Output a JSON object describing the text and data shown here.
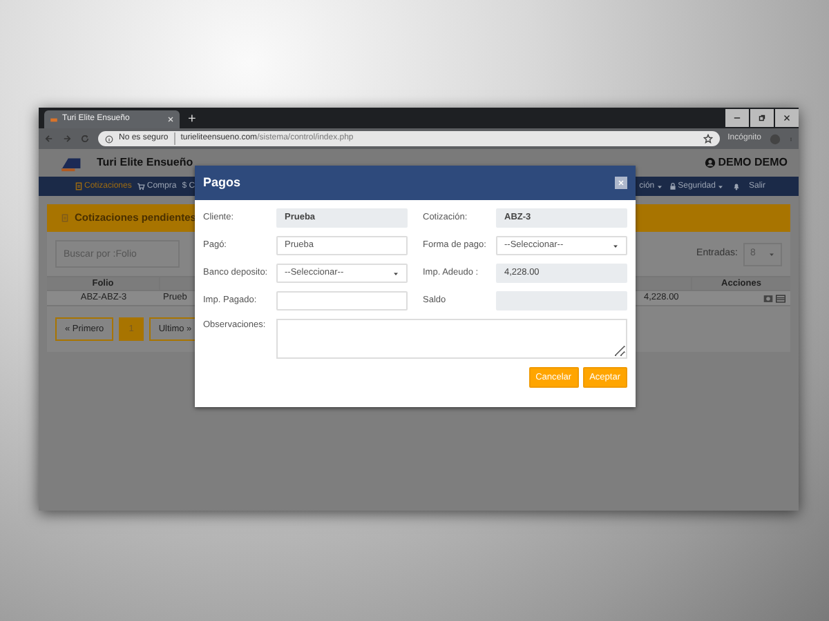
{
  "browser": {
    "tab_title": "Turi Elite Ensueño",
    "new_tab": "+",
    "security": "No es seguro",
    "url_host": "turieliteensueno.com",
    "url_path": "/sistema/control/index.php",
    "profile": "Incógnito"
  },
  "app": {
    "brand": "Turi Elite Ensueño",
    "user": "DEMO DEMO",
    "nav": [
      {
        "label": "Cotizaciones",
        "kind": "document",
        "selected": true
      },
      {
        "label": "Compra",
        "kind": "cart",
        "selected": false
      },
      {
        "label": "$ C",
        "kind": "text",
        "selected": false
      },
      {
        "label": "ción",
        "kind": "menu",
        "selected": false
      },
      {
        "label": "Seguridad",
        "kind": "lock-menu",
        "selected": false
      },
      {
        "kind": "bell",
        "selected": false
      },
      {
        "label": "Salir",
        "kind": "text",
        "selected": false
      }
    ]
  },
  "page": {
    "title": "Cotizaciones pendientes",
    "search": {
      "placeholder": "Buscar por :Folio"
    },
    "entries_label": "Entradas:",
    "entries_value": "8",
    "table": {
      "columns": [
        "Folio",
        "",
        "",
        "Acciones"
      ],
      "rows": [
        [
          "ABZ-ABZ-3",
          "Prueb",
          "4,228.00",
          ""
        ]
      ]
    },
    "pagination": [
      {
        "label": "« Primero",
        "selected": false
      },
      {
        "label": "1",
        "selected": true
      },
      {
        "label": "Ultimo »",
        "selected": false
      }
    ]
  },
  "modal": {
    "title": "Pagos",
    "fields": [
      {
        "label": "Cliente:",
        "kind": "readonly",
        "value": "Prueba",
        "strong": true
      },
      {
        "label": "Cotización:",
        "kind": "readonly",
        "value": "ABZ-3",
        "strong": true
      },
      {
        "label": "Pagó:",
        "kind": "input",
        "value": "Prueba",
        "strong": false
      },
      {
        "label": "Forma de pago:",
        "kind": "select",
        "value": "--Seleccionar--",
        "strong": false
      },
      {
        "label": "Banco deposito:",
        "kind": "select",
        "value": "--Seleccionar--",
        "strong": false
      },
      {
        "label": "Imp. Adeudo :",
        "kind": "readonly",
        "value": "4,228.00",
        "strong": false
      },
      {
        "label": "Imp. Pagado:",
        "kind": "input"
      },
      {
        "label": "Saldo",
        "kind": "readonly"
      },
      {
        "label": "Observaciones:",
        "kind": "textarea"
      }
    ],
    "buttons": [
      "Cancelar",
      "Aceptar"
    ]
  }
}
